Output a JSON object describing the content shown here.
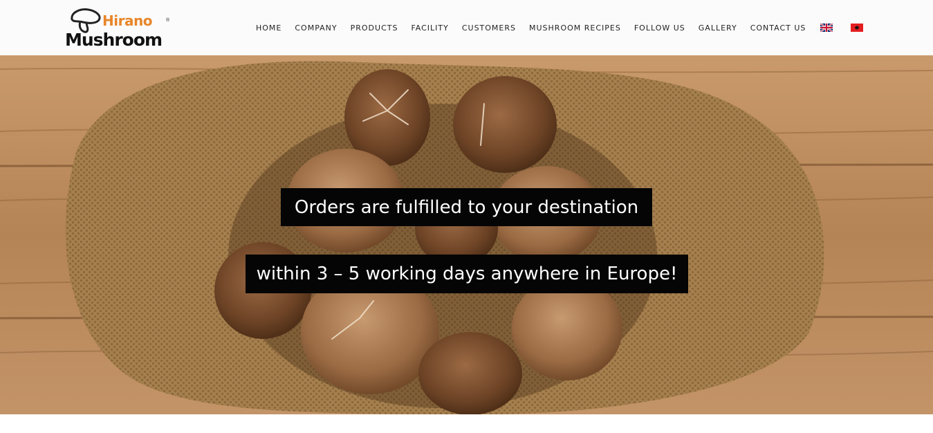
{
  "brand": {
    "name_top": "Hirano",
    "name_bottom": "Mushroom",
    "registered_mark": "®",
    "accent_color": "#e8862a"
  },
  "nav": {
    "items": [
      {
        "label": "HOME"
      },
      {
        "label": "COMPANY"
      },
      {
        "label": "PRODUCTS"
      },
      {
        "label": "FACILITY"
      },
      {
        "label": "CUSTOMERS"
      },
      {
        "label": "MUSHROOM RECIPES"
      },
      {
        "label": "FOLLOW US"
      },
      {
        "label": "GALLERY"
      },
      {
        "label": "CONTACT US"
      }
    ],
    "languages": [
      {
        "icon": "uk-flag-icon"
      },
      {
        "icon": "albania-flag-icon"
      }
    ]
  },
  "hero": {
    "caption_line1": "Orders are fulfilled to your destination",
    "caption_line2": "within 3 – 5 working days anywhere in Europe!",
    "caption_bg": "#050505",
    "caption_color": "#ffffff"
  }
}
